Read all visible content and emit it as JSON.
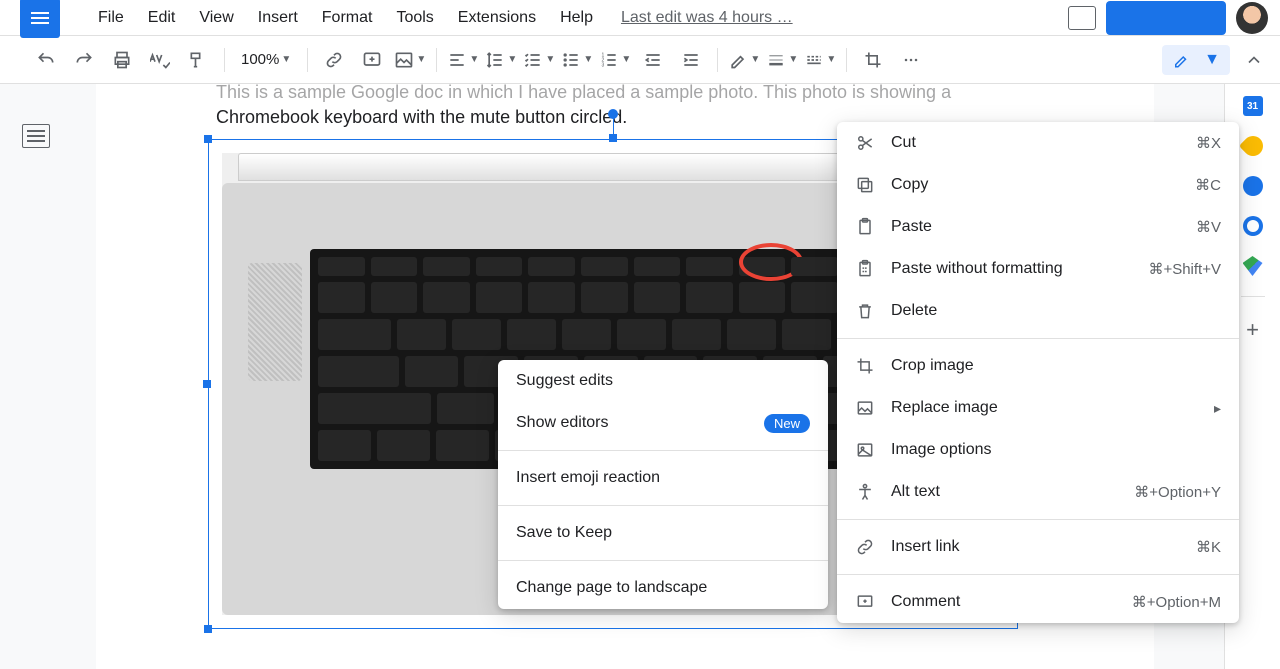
{
  "menu": {
    "items": [
      "File",
      "Edit",
      "View",
      "Insert",
      "Format",
      "Tools",
      "Extensions",
      "Help"
    ],
    "last_edit": "Last edit was 4 hours …"
  },
  "toolbar": {
    "zoom": "100%"
  },
  "doc": {
    "line1": "This is a sample Google doc in which I have placed a sample photo. This photo is showing a",
    "line2": "Chromebook keyboard with the mute button circled."
  },
  "ctx_left": {
    "items": [
      {
        "label": "Suggest edits"
      },
      {
        "label": "Show editors",
        "badge": "New"
      }
    ],
    "group2": [
      {
        "label": "Insert emoji reaction"
      }
    ],
    "group3": [
      {
        "label": "Save to Keep"
      }
    ],
    "group4": [
      {
        "label": "Change page to landscape"
      }
    ]
  },
  "ctx_right": {
    "edit": [
      {
        "label": "Cut",
        "shortcut": "⌘X"
      },
      {
        "label": "Copy",
        "shortcut": "⌘C"
      },
      {
        "label": "Paste",
        "shortcut": "⌘V"
      },
      {
        "label": "Paste without formatting",
        "shortcut": "⌘+Shift+V"
      },
      {
        "label": "Delete"
      }
    ],
    "image": [
      {
        "label": "Crop image"
      },
      {
        "label": "Replace image",
        "submenu": true
      },
      {
        "label": "Image options"
      },
      {
        "label": "Alt text",
        "shortcut": "⌘+Option+Y"
      }
    ],
    "misc": [
      {
        "label": "Insert link",
        "shortcut": "⌘K"
      }
    ],
    "comment": [
      {
        "label": "Comment",
        "shortcut": "⌘+Option+M"
      }
    ]
  }
}
